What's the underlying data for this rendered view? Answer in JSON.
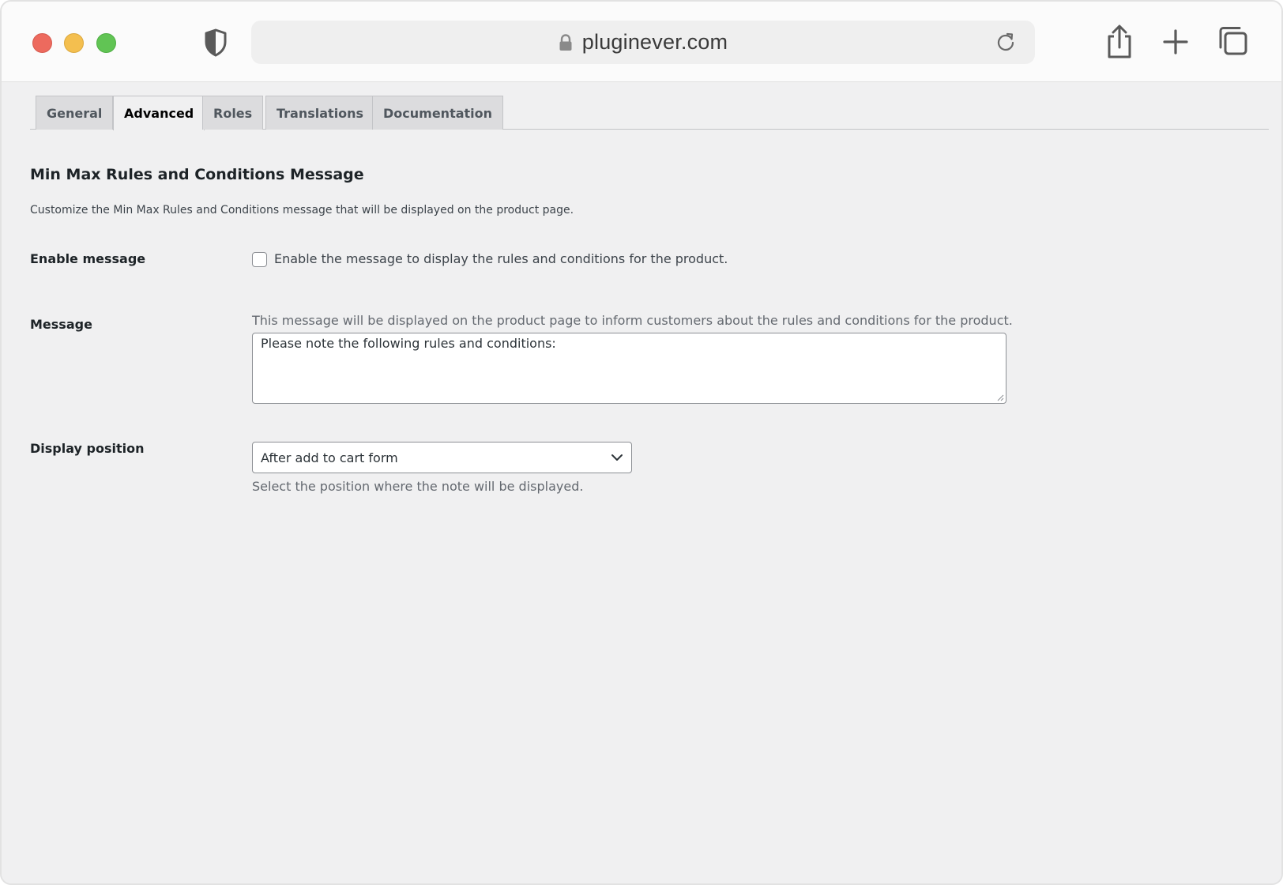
{
  "browser": {
    "url": "pluginever.com"
  },
  "tabs": [
    {
      "label": "General",
      "active": false
    },
    {
      "label": "Advanced",
      "active": true
    },
    {
      "label": "Roles",
      "active": false
    },
    {
      "label": "Translations",
      "active": false
    },
    {
      "label": "Documentation",
      "active": false
    }
  ],
  "section": {
    "title": "Min Max Rules and Conditions Message",
    "description": "Customize the Min Max Rules and Conditions message that will be displayed on the product page."
  },
  "fields": {
    "enable": {
      "label": "Enable message",
      "checkbox_label": "Enable the message to display the rules and conditions for the product.",
      "checked": false
    },
    "message": {
      "label": "Message",
      "help": "This message will be displayed on the product page to inform customers about the rules and conditions for the product.",
      "value": "Please note the following rules and conditions:"
    },
    "position": {
      "label": "Display position",
      "selected": "After add to cart form",
      "help": "Select the position where the note will be displayed."
    }
  }
}
